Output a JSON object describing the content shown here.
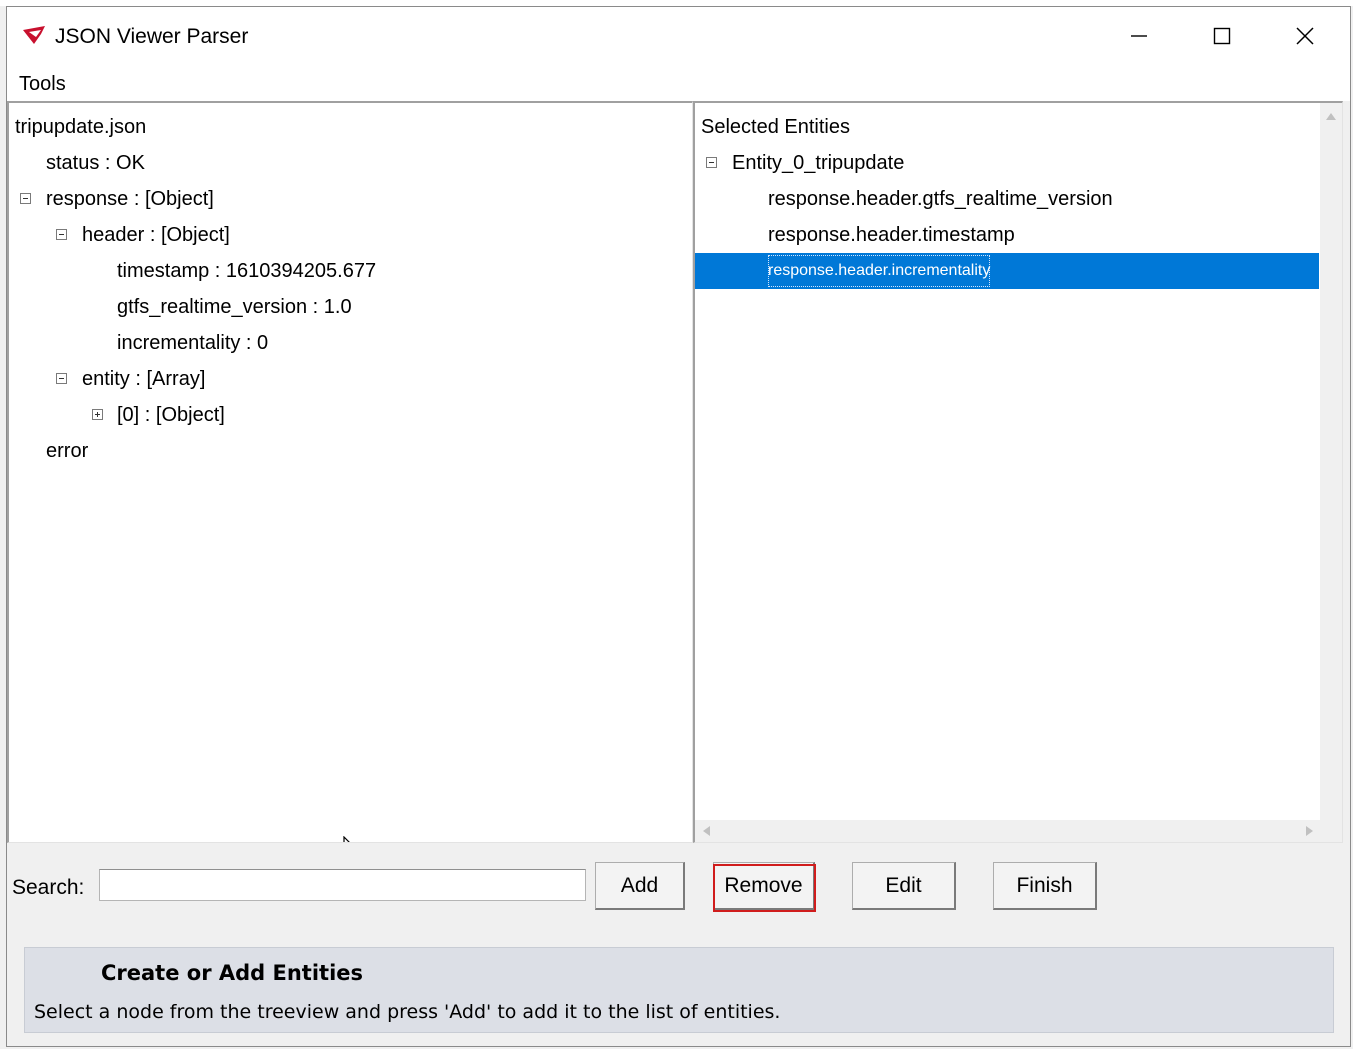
{
  "window": {
    "title": "JSON Viewer Parser",
    "icon": "app-logo-icon"
  },
  "menu": {
    "items": [
      "Tools"
    ]
  },
  "left_tree": {
    "root": "tripupdate.json",
    "nodes": [
      {
        "text": "status : OK",
        "expander": "none"
      },
      {
        "text": "response : [Object]",
        "expander": "collapse"
      },
      {
        "text": "header : [Object]",
        "expander": "collapse"
      },
      {
        "text": "timestamp : 1610394205.677",
        "expander": "none"
      },
      {
        "text": "gtfs_realtime_version : 1.0",
        "expander": "none"
      },
      {
        "text": "incrementality : 0",
        "expander": "none"
      },
      {
        "text": "entity : [Array]",
        "expander": "collapse"
      },
      {
        "text": "[0] : [Object]",
        "expander": "expand"
      },
      {
        "text": "error",
        "expander": "none"
      }
    ]
  },
  "right_tree": {
    "root": "Selected Entities",
    "group": "Entity_0_tripupdate",
    "items": [
      "response.header.gtfs_realtime_version",
      "response.header.timestamp",
      "response.header.incrementality"
    ],
    "selected_item": "response.header.incrementality"
  },
  "search": {
    "label": "Search:",
    "value": "",
    "placeholder": ""
  },
  "buttons": {
    "add": "Add",
    "remove": "Remove",
    "edit": "Edit",
    "finish": "Finish"
  },
  "help": {
    "title": "Create or Add Entities",
    "text": "Select a node from the treeview and press 'Add' to add it to the list of entities."
  },
  "colors": {
    "selection": "#0078d7",
    "highlight_border": "#d01c1c",
    "help_background": "#dcdfe6",
    "logo_red": "#c8102e"
  }
}
